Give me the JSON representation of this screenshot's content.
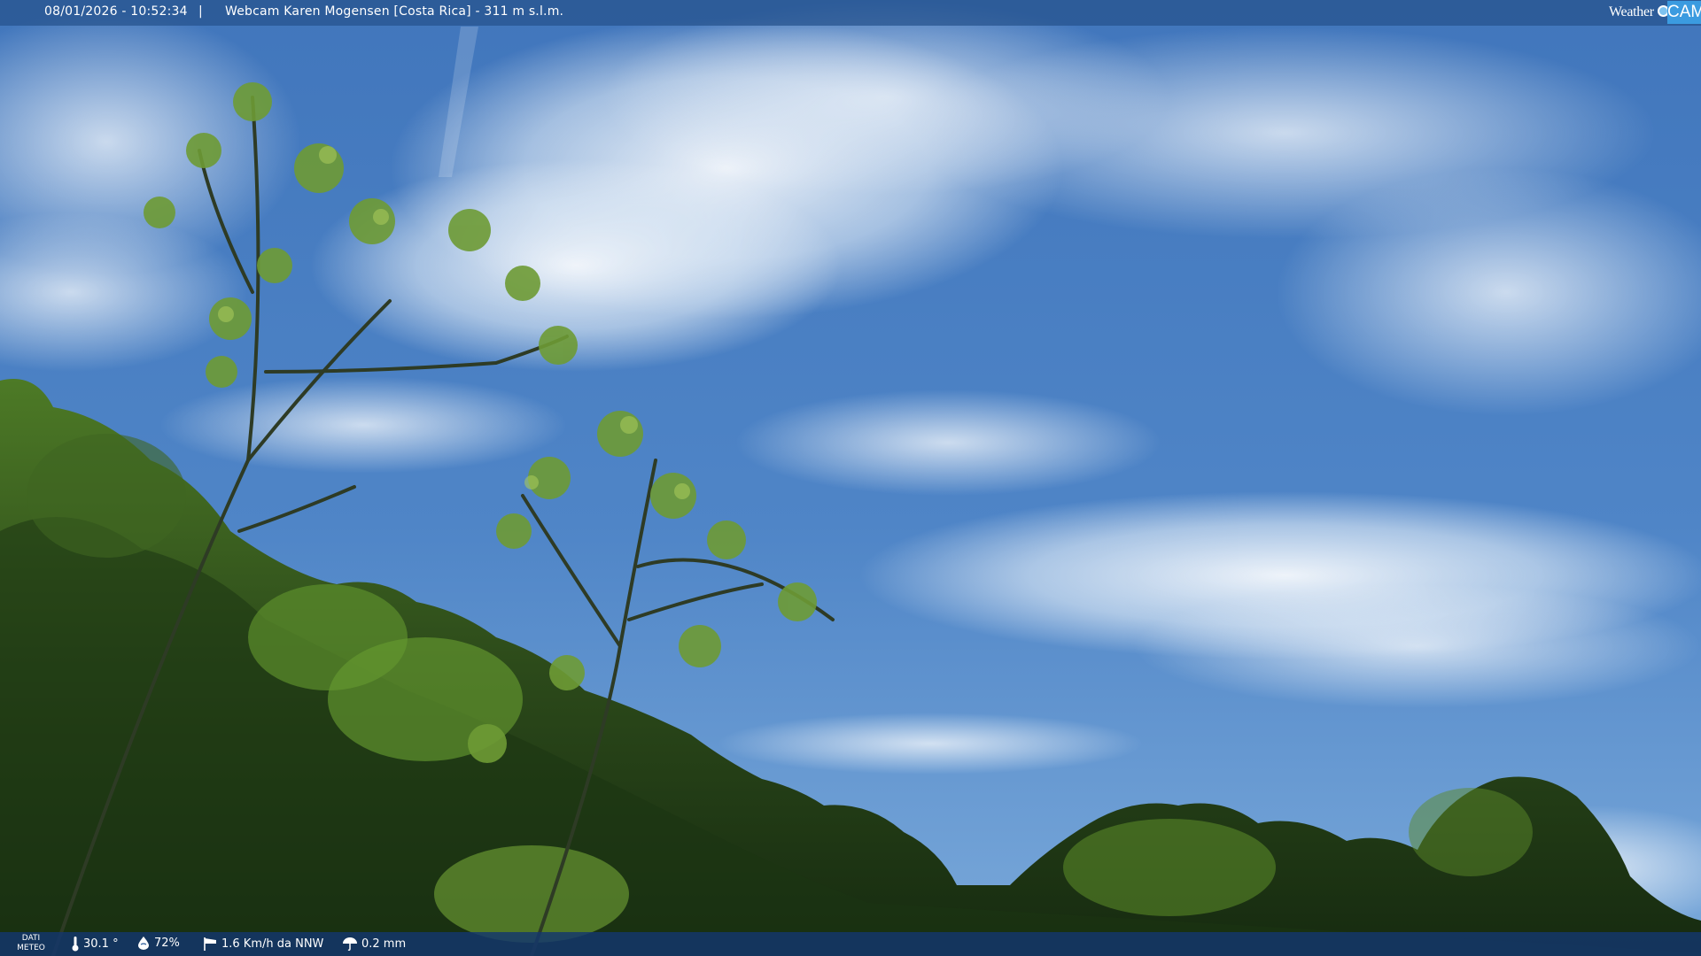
{
  "overlay_top": {
    "timestamp": "08/01/2026 - 10:52:34",
    "separator": "|",
    "title": "Webcam Karen Mogensen [Costa Rica] - 311 m s.l.m."
  },
  "logo": {
    "word": "Weather",
    "cam": "CAM"
  },
  "overlay_bottom": {
    "label": "DATI METEO",
    "temperature": "30.1 °",
    "humidity": "72%",
    "wind": "1.6 Km/h da NNW",
    "rain": "0.2 mm"
  },
  "icons": {
    "temperature": "thermometer-icon",
    "humidity": "humidity-drop-icon",
    "wind": "wind-sock-icon",
    "rain": "umbrella-icon"
  },
  "colors": {
    "sky_top": "#3d70b8",
    "sky_bottom": "#6b9fd6",
    "foliage_dark": "#1f3a16",
    "foliage_light": "#6a9a2e",
    "bar": "#26528c"
  }
}
